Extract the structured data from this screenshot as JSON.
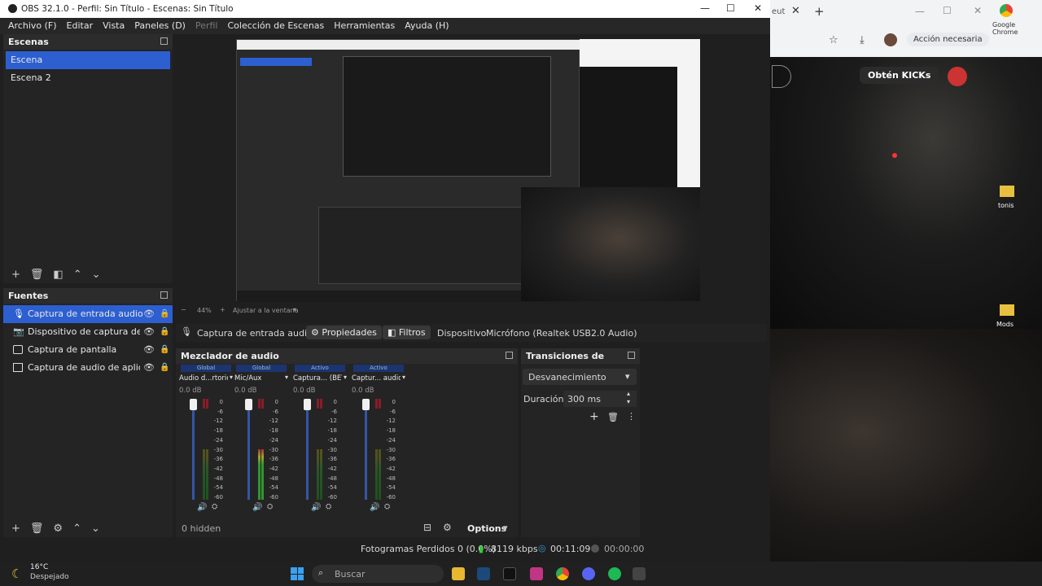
{
  "window": {
    "title": "OBS 32.1.0 - Perfil: Sin Título - Escenas: Sin Título",
    "controls": [
      "minimize",
      "maximize",
      "close"
    ]
  },
  "menu": [
    "Archivo (F)",
    "Editar",
    "Vista",
    "Paneles (D)",
    "Perfil",
    "Colección de Escenas",
    "Herramientas",
    "Ayuda (H)"
  ],
  "scenes": {
    "title": "Escenas",
    "items": [
      "Escena",
      "Escena 2"
    ],
    "selected": 0
  },
  "sources": {
    "title": "Fuentes",
    "items": [
      {
        "label": "Captura de entrada audio",
        "icon": "microphone-icon"
      },
      {
        "label": "Dispositivo de captura de vídeo",
        "icon": "camera-icon"
      },
      {
        "label": "Captura de pantalla",
        "icon": "monitor-icon"
      },
      {
        "label": "Captura de audio de aplicación",
        "icon": "app-audio-icon"
      }
    ]
  },
  "preview": {
    "zoom": "44%",
    "fit": "Ajustar a la ventana"
  },
  "context_bar": {
    "source": "Captura de entrada audio",
    "properties": "Propiedades",
    "filters": "Filtros",
    "device_label": "Dispositivo",
    "device_value": "Micrófono (Realtek USB2.0 Audio)"
  },
  "mixer": {
    "title": "Mezclador de audio",
    "channels": [
      {
        "badge": "Global",
        "name": "Audio d...rtorio",
        "db": "0.0 dB",
        "level": 0.0
      },
      {
        "badge": "Global",
        "name": "Mic/Aux",
        "db": "0.0 dB",
        "level": 0.55
      },
      {
        "badge": "Activo",
        "name": "Captura... (BETA)",
        "db": "0.0 dB",
        "level": 0.0
      },
      {
        "badge": "Activo",
        "name": "Captur... audio",
        "db": "0.0 dB",
        "level": 0.0
      }
    ],
    "scale": [
      "0",
      "-6",
      "-12",
      "-18",
      "-24",
      "-30",
      "-36",
      "-42",
      "-48",
      "-54",
      "-60"
    ],
    "hidden": "0 hidden",
    "options": "Options"
  },
  "transitions": {
    "title": "Transiciones de escena",
    "selected": "Desvanecimiento",
    "duration_label": "Duración",
    "duration_value": "300 ms"
  },
  "status": {
    "dropped": "Fotogramas Perdidos 0 (0.0%)",
    "bitrate": "8119 kbps",
    "stream_time": "00:11:09",
    "rec_time": "00:00:00"
  },
  "chrome": {
    "tab_fragment": "eut",
    "action": "Acción necesaria",
    "kick_label": "Obtén KICKs",
    "desktop_chrome": "Google Chrome",
    "desktop_folder": "tonis",
    "desktop_folder2": "Mods"
  },
  "taskbar": {
    "weather_temp": "16°C",
    "weather_desc": "Despejado",
    "search_placeholder": "Buscar"
  }
}
